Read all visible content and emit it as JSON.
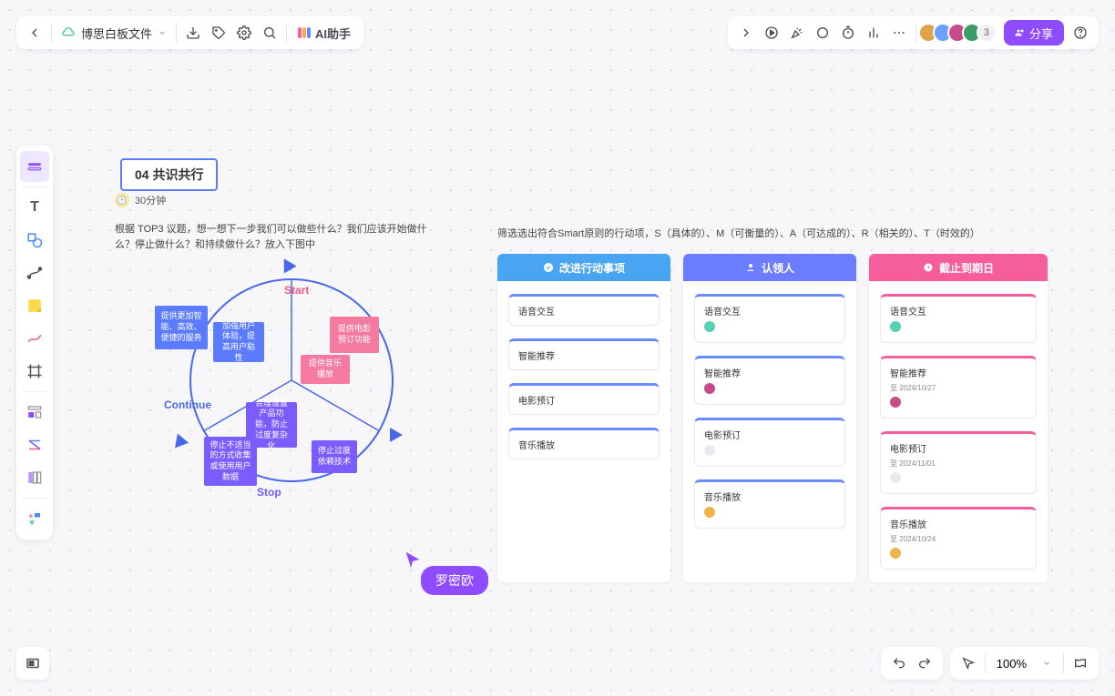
{
  "header": {
    "filename": "博思白板文件",
    "ai_label": "AI助手"
  },
  "collab": {
    "extra_count": "3",
    "share_label": "分享"
  },
  "zoom": {
    "level": "100%"
  },
  "section": {
    "title": "04 共识共行",
    "time": "30分钟",
    "desc1": "根据 TOP3 议题，想一想下一步我们可以做些什么？我们应该开始做什么？停止做什么？和持续做什么？放入下图中",
    "desc2": "筛选选出符合Smart原则的行动项，S（具体的）、M（可衡量的）、A（可达成的）、R（相关的）、T（时效的）"
  },
  "diagram": {
    "start_label": "Start",
    "continue_label": "Continue",
    "stop_label": "Stop",
    "notes": {
      "n1": "提供更加智能、高效、便捷的服务",
      "n2": "加强用户体验，提高用户粘性",
      "n3": "提供电影预订功能",
      "n4": "提供音乐播放",
      "n5": "合理设置产品功能，防止过度复杂化",
      "n6": "停止不适当的方式收集或使用用户数据",
      "n7": "停止过度依赖技术"
    }
  },
  "columns": {
    "c1": {
      "title": "改进行动事项",
      "color": "#49a4f2",
      "items": [
        "语音交互",
        "智能推荐",
        "电影预订",
        "音乐播放"
      ]
    },
    "c2": {
      "title": "认领人",
      "color": "#6d7dff",
      "items": [
        "语音交互",
        "智能推荐",
        "电影预订",
        "音乐播放"
      ]
    },
    "c3": {
      "title": "截止到期日",
      "color": "#f55d9b",
      "items": [
        {
          "t": "语音交互",
          "d": ""
        },
        {
          "t": "智能推荐",
          "d": "至 2024/10/27"
        },
        {
          "t": "电影预订",
          "d": "至 2024/11/01"
        },
        {
          "t": "音乐播放",
          "d": "至 2024/10/24"
        }
      ]
    }
  },
  "cursor_user": "罗密欧",
  "avatar_colors": [
    "#e2a24a",
    "#6aa0ff",
    "#c74b8a",
    "#3b9c66"
  ]
}
